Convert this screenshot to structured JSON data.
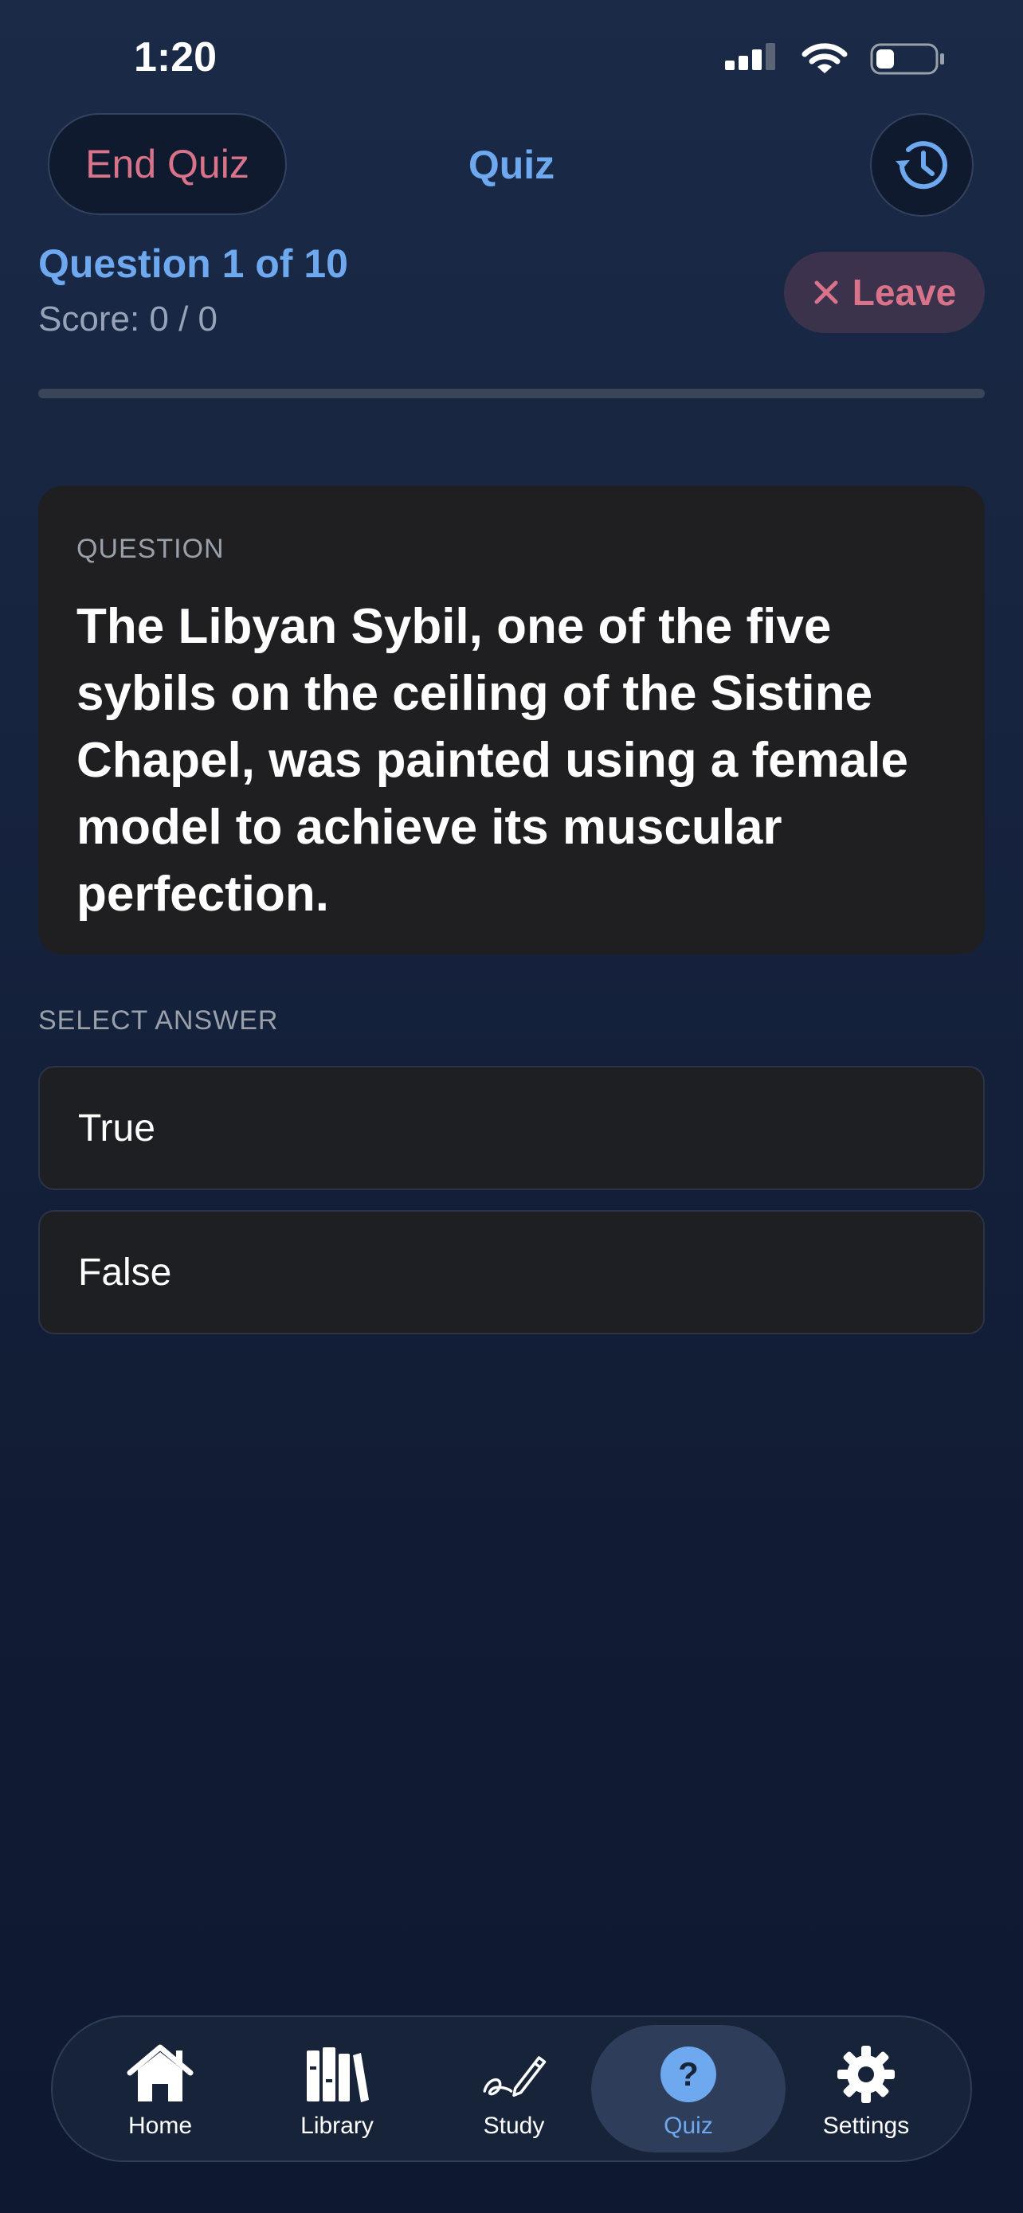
{
  "status": {
    "time": "1:20"
  },
  "header": {
    "end_quiz_label": "End Quiz",
    "title": "Quiz"
  },
  "progress": {
    "question_count": "Question 1 of 10",
    "score": "Score: 0 / 0",
    "leave_label": "Leave",
    "fraction": 0
  },
  "question": {
    "label": "QUESTION",
    "text": "The Libyan Sybil, one of the five sybils on the ceiling of the Sistine Chapel, was painted using a female model to achieve its muscular perfection."
  },
  "answers": {
    "label": "SELECT ANSWER",
    "options": [
      "True",
      "False"
    ]
  },
  "tabs": [
    {
      "label": "Home",
      "icon": "home-icon"
    },
    {
      "label": "Library",
      "icon": "library-icon"
    },
    {
      "label": "Study",
      "icon": "study-icon"
    },
    {
      "label": "Quiz",
      "icon": "quiz-icon",
      "active": true
    },
    {
      "label": "Settings",
      "icon": "gear-icon"
    }
  ],
  "colors": {
    "accent": "#6ea8ee",
    "danger": "#d9738a",
    "card": "#1f1f21"
  }
}
